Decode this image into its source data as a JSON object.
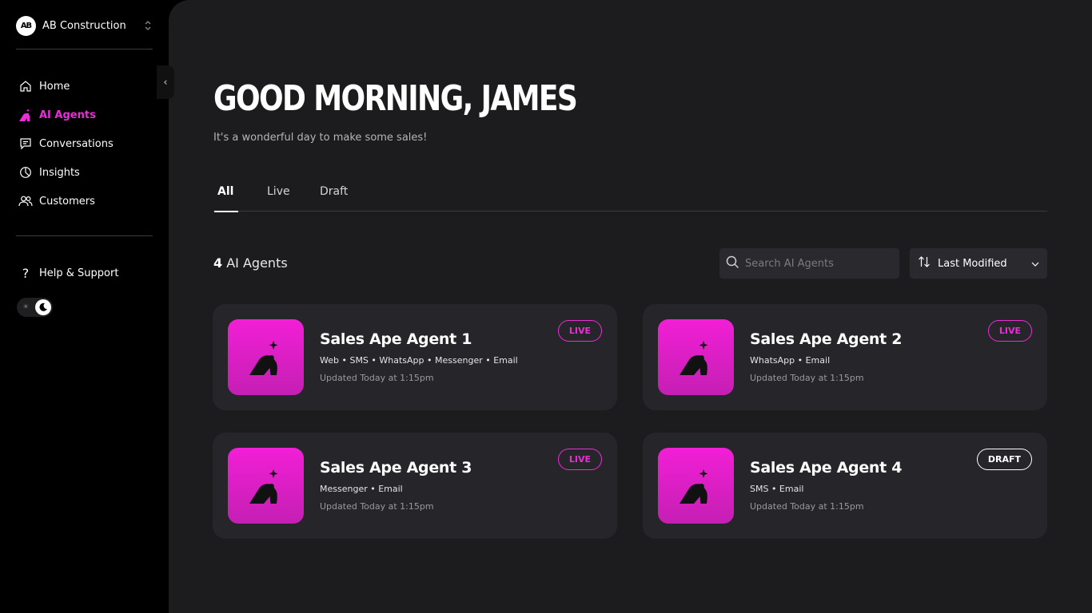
{
  "colors": {
    "accent": "#ec2cd9",
    "sidebar_bg": "#000000",
    "main_bg": "#1c1b1d",
    "card_bg": "#262529"
  },
  "org": {
    "logo_text": "AB",
    "name": "AB Construction"
  },
  "nav": {
    "items": [
      {
        "label": "Home",
        "icon": "home-icon",
        "active": false
      },
      {
        "label": "AI Agents",
        "icon": "ape-icon",
        "active": true
      },
      {
        "label": "Conversations",
        "icon": "chat-icon",
        "active": false
      },
      {
        "label": "Insights",
        "icon": "pie-chart-icon",
        "active": false
      },
      {
        "label": "Customers",
        "icon": "users-icon",
        "active": false
      }
    ],
    "help_label": "Help & Support"
  },
  "main": {
    "greeting": "GOOD MORNING, JAMES",
    "subtitle": "It's a wonderful day to make some sales!",
    "tabs": [
      {
        "label": "All",
        "active": true
      },
      {
        "label": "Live",
        "active": false
      },
      {
        "label": "Draft",
        "active": false
      }
    ],
    "count_number": "4",
    "count_label": "AI Agents",
    "search_placeholder": "Search AI Agents",
    "sort_label": "Last Modified"
  },
  "agents": [
    {
      "name": "Sales Ape Agent 1",
      "channels": "Web • SMS • WhatsApp • Messenger • Email",
      "updated": "Updated Today at 1:15pm",
      "status": "LIVE"
    },
    {
      "name": "Sales Ape Agent 2",
      "channels": "WhatsApp • Email",
      "updated": "Updated Today at 1:15pm",
      "status": "LIVE"
    },
    {
      "name": "Sales Ape Agent 3",
      "channels": "Messenger • Email",
      "updated": "Updated Today at 1:15pm",
      "status": "LIVE"
    },
    {
      "name": "Sales Ape Agent 4",
      "channels": "SMS • Email",
      "updated": "Updated Today at 1:15pm",
      "status": "DRAFT"
    }
  ]
}
